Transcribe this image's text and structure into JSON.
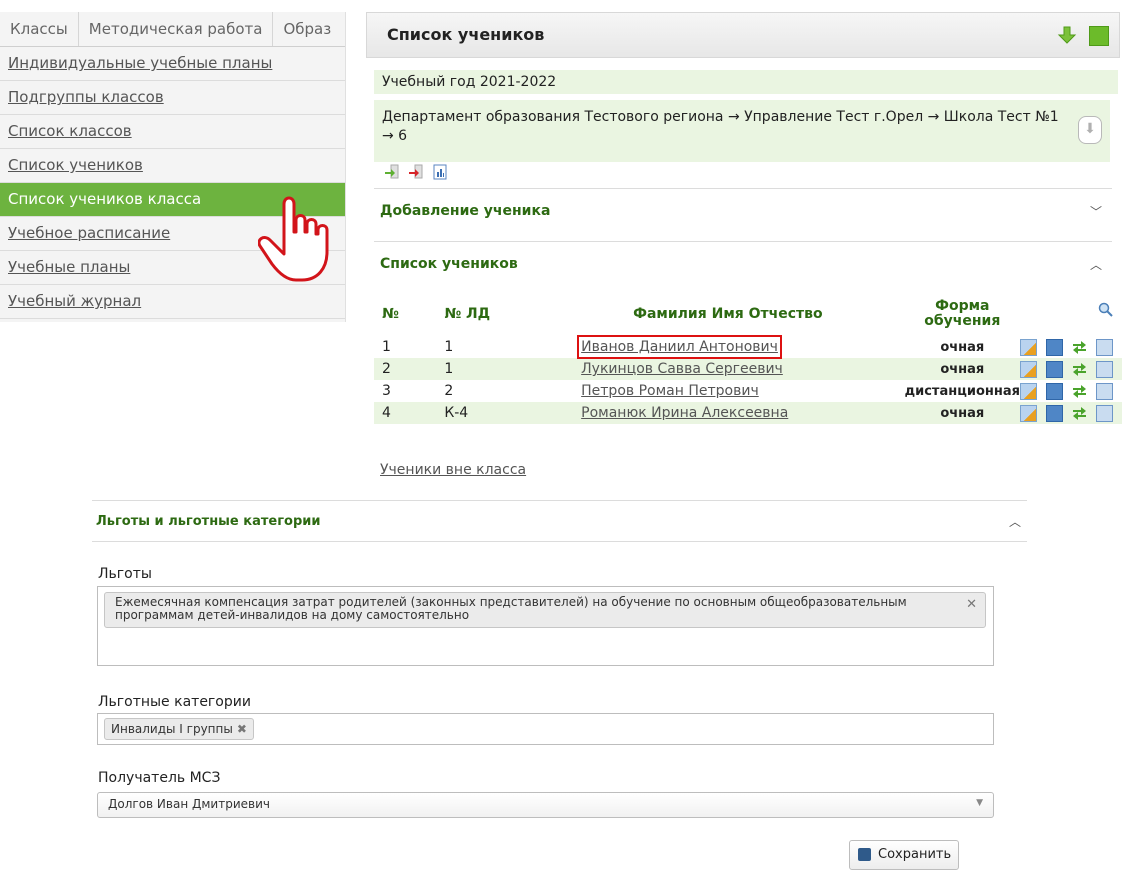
{
  "left_nav": {
    "tabs": [
      "Классы",
      "Методическая работа",
      "Образ"
    ],
    "items": [
      "Индивидуальные учебные планы",
      "Подгруппы классов",
      "Список классов",
      "Список учеников",
      "Список учеников класса",
      "Учебное расписание",
      "Учебные планы",
      "Учебный журнал"
    ],
    "active_index": 4
  },
  "students_panel": {
    "title": "Список учеников",
    "year": "Учебный год 2021-2022",
    "path": "Департамент образования Тестового региона → Управление Тест г.Орел → Школа Тест №1 → 6",
    "add_section": "Добавление ученика",
    "list_section": "Список учеников",
    "columns": {
      "no": "№",
      "ld": "№ ЛД",
      "fio": "Фамилия Имя Отчество",
      "form": "Форма обучения"
    },
    "rows": [
      {
        "no": "1",
        "ld": "1",
        "fio": "Иванов Даниил Антонович",
        "form": "очная"
      },
      {
        "no": "2",
        "ld": "1",
        "fio": "Лукинцов Савва Сергеевич",
        "form": "очная"
      },
      {
        "no": "3",
        "ld": "2",
        "fio": "Петров Роман Петрович",
        "form": "дистанционная"
      },
      {
        "no": "4",
        "ld": "К-4",
        "fio": "Романюк Ирина Алексеевна",
        "form": "очная"
      }
    ],
    "outside_link": "Ученики вне класса"
  },
  "benefits_form": {
    "section_title": "Льготы и льготные категории",
    "benefits_label": "Льготы",
    "benefit_tag": "Ежемесячная компенсация затрат родителей (законных представителей) на обучение по основным общеобразовательным программам детей-инвалидов на дому самостоятельно",
    "categories_label": "Льготные категории",
    "category_tag": "Инвалиды I группы",
    "recipient_label": "Получатель МСЗ",
    "recipient_value": "Долгов Иван Дмитриевич",
    "save_label": "Сохранить"
  },
  "colors": {
    "accent_green": "#6db33f",
    "section_text": "#2d6a12",
    "light_green_row": "#eaf5e1",
    "highlight_red": "#dd1111"
  },
  "icons": [
    "pointer-hand-icon",
    "download-arrow-icon",
    "green-square-icon",
    "import-icon",
    "export-icon",
    "report-icon",
    "search-icon",
    "edit-icon",
    "book-icon",
    "move-icon",
    "card-icon",
    "remove-icon",
    "save-icon",
    "chevron-up-icon",
    "chevron-down-icon"
  ]
}
